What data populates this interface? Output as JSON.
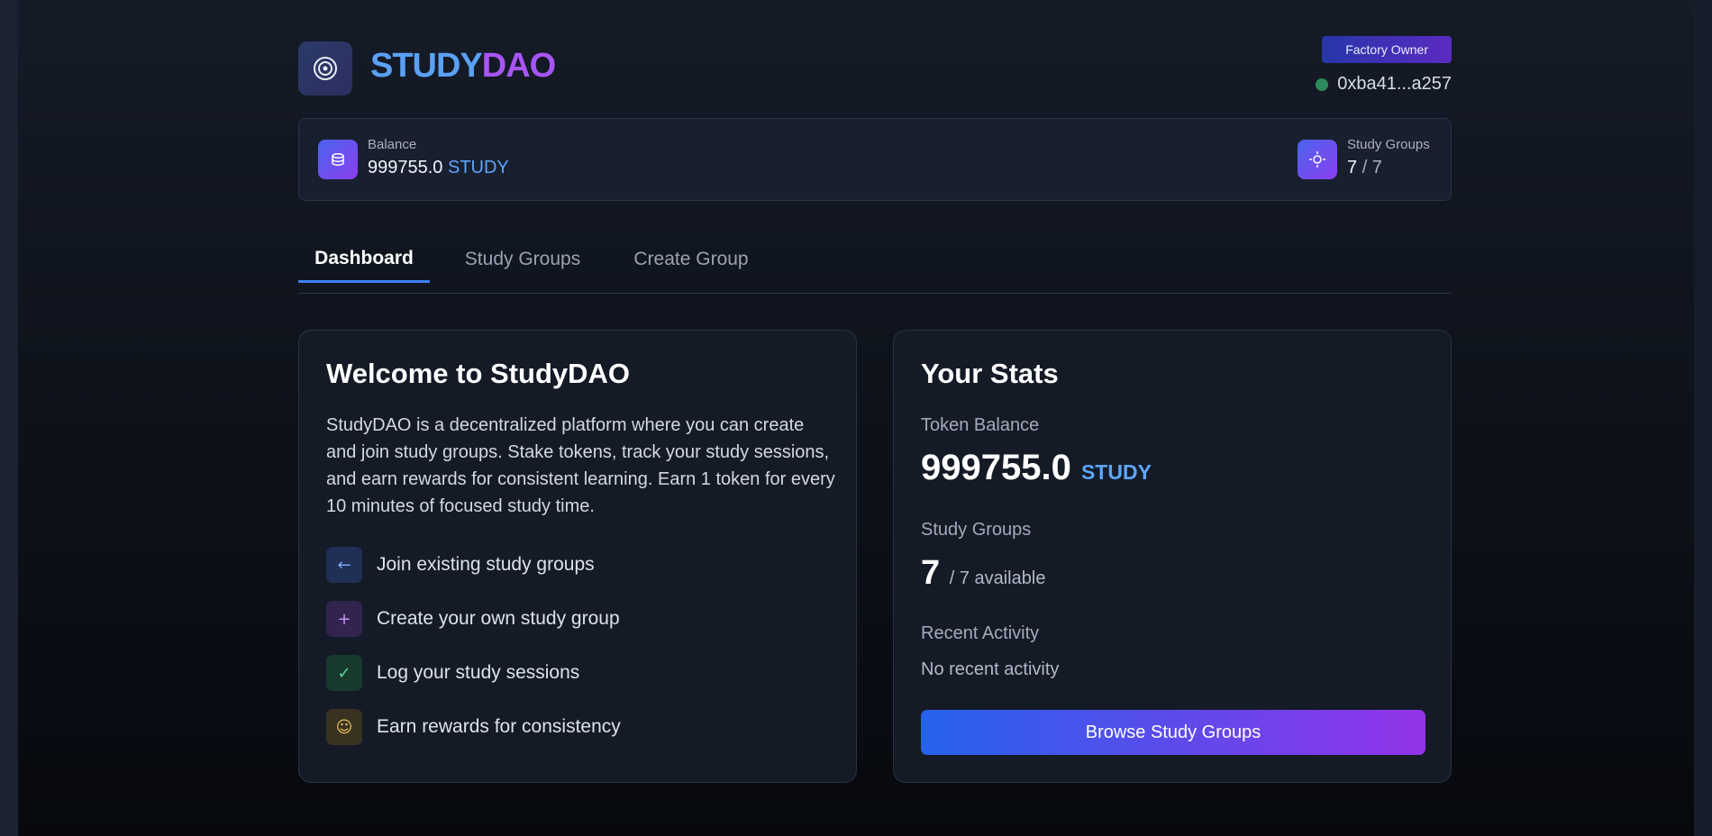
{
  "header": {
    "brand_part1": "STUDY",
    "brand_part2": "DAO",
    "role_badge": "Factory Owner",
    "wallet_address": "0xba41...a257",
    "logo_icon": "target-icon"
  },
  "balance_bar": {
    "balance_label": "Balance",
    "balance_value": "999755.0",
    "balance_unit": "STUDY",
    "groups_label": "Study Groups",
    "groups_current": "7",
    "groups_total": "/ 7"
  },
  "tabs": [
    {
      "label": "Dashboard",
      "active": true
    },
    {
      "label": "Study Groups",
      "active": false
    },
    {
      "label": "Create Group",
      "active": false
    }
  ],
  "welcome": {
    "title": "Welcome to StudyDAO",
    "intro": "StudyDAO is a decentralized platform where you can create and join study groups. Stake tokens, track your study sessions, and earn rewards for consistent learning. Earn 1 token for every 10 minutes of focused study time.",
    "features": [
      {
        "label": "Join existing study groups",
        "icon": "arrow-left-icon",
        "color": "#7aa5f0"
      },
      {
        "label": "Create your own study group",
        "icon": "plus-icon",
        "color": "#c293f5"
      },
      {
        "label": "Log your study sessions",
        "icon": "check-icon",
        "color": "#5fd49a"
      },
      {
        "label": "Earn rewards for consistency",
        "icon": "reward-icon",
        "color": "#e8c15a"
      }
    ]
  },
  "stats": {
    "title": "Your Stats",
    "token_balance_label": "Token Balance",
    "token_balance_value": "999755.0",
    "token_unit": "STUDY",
    "groups_label": "Study Groups",
    "groups_value": "7",
    "groups_available": "/ 7 available",
    "recent_label": "Recent Activity",
    "recent_value": "No recent activity",
    "button_label": "Browse Study Groups"
  },
  "colors": {
    "accent_blue": "#3b82f6",
    "accent_purple": "#a855f7",
    "status_online": "#2f8a5b"
  }
}
